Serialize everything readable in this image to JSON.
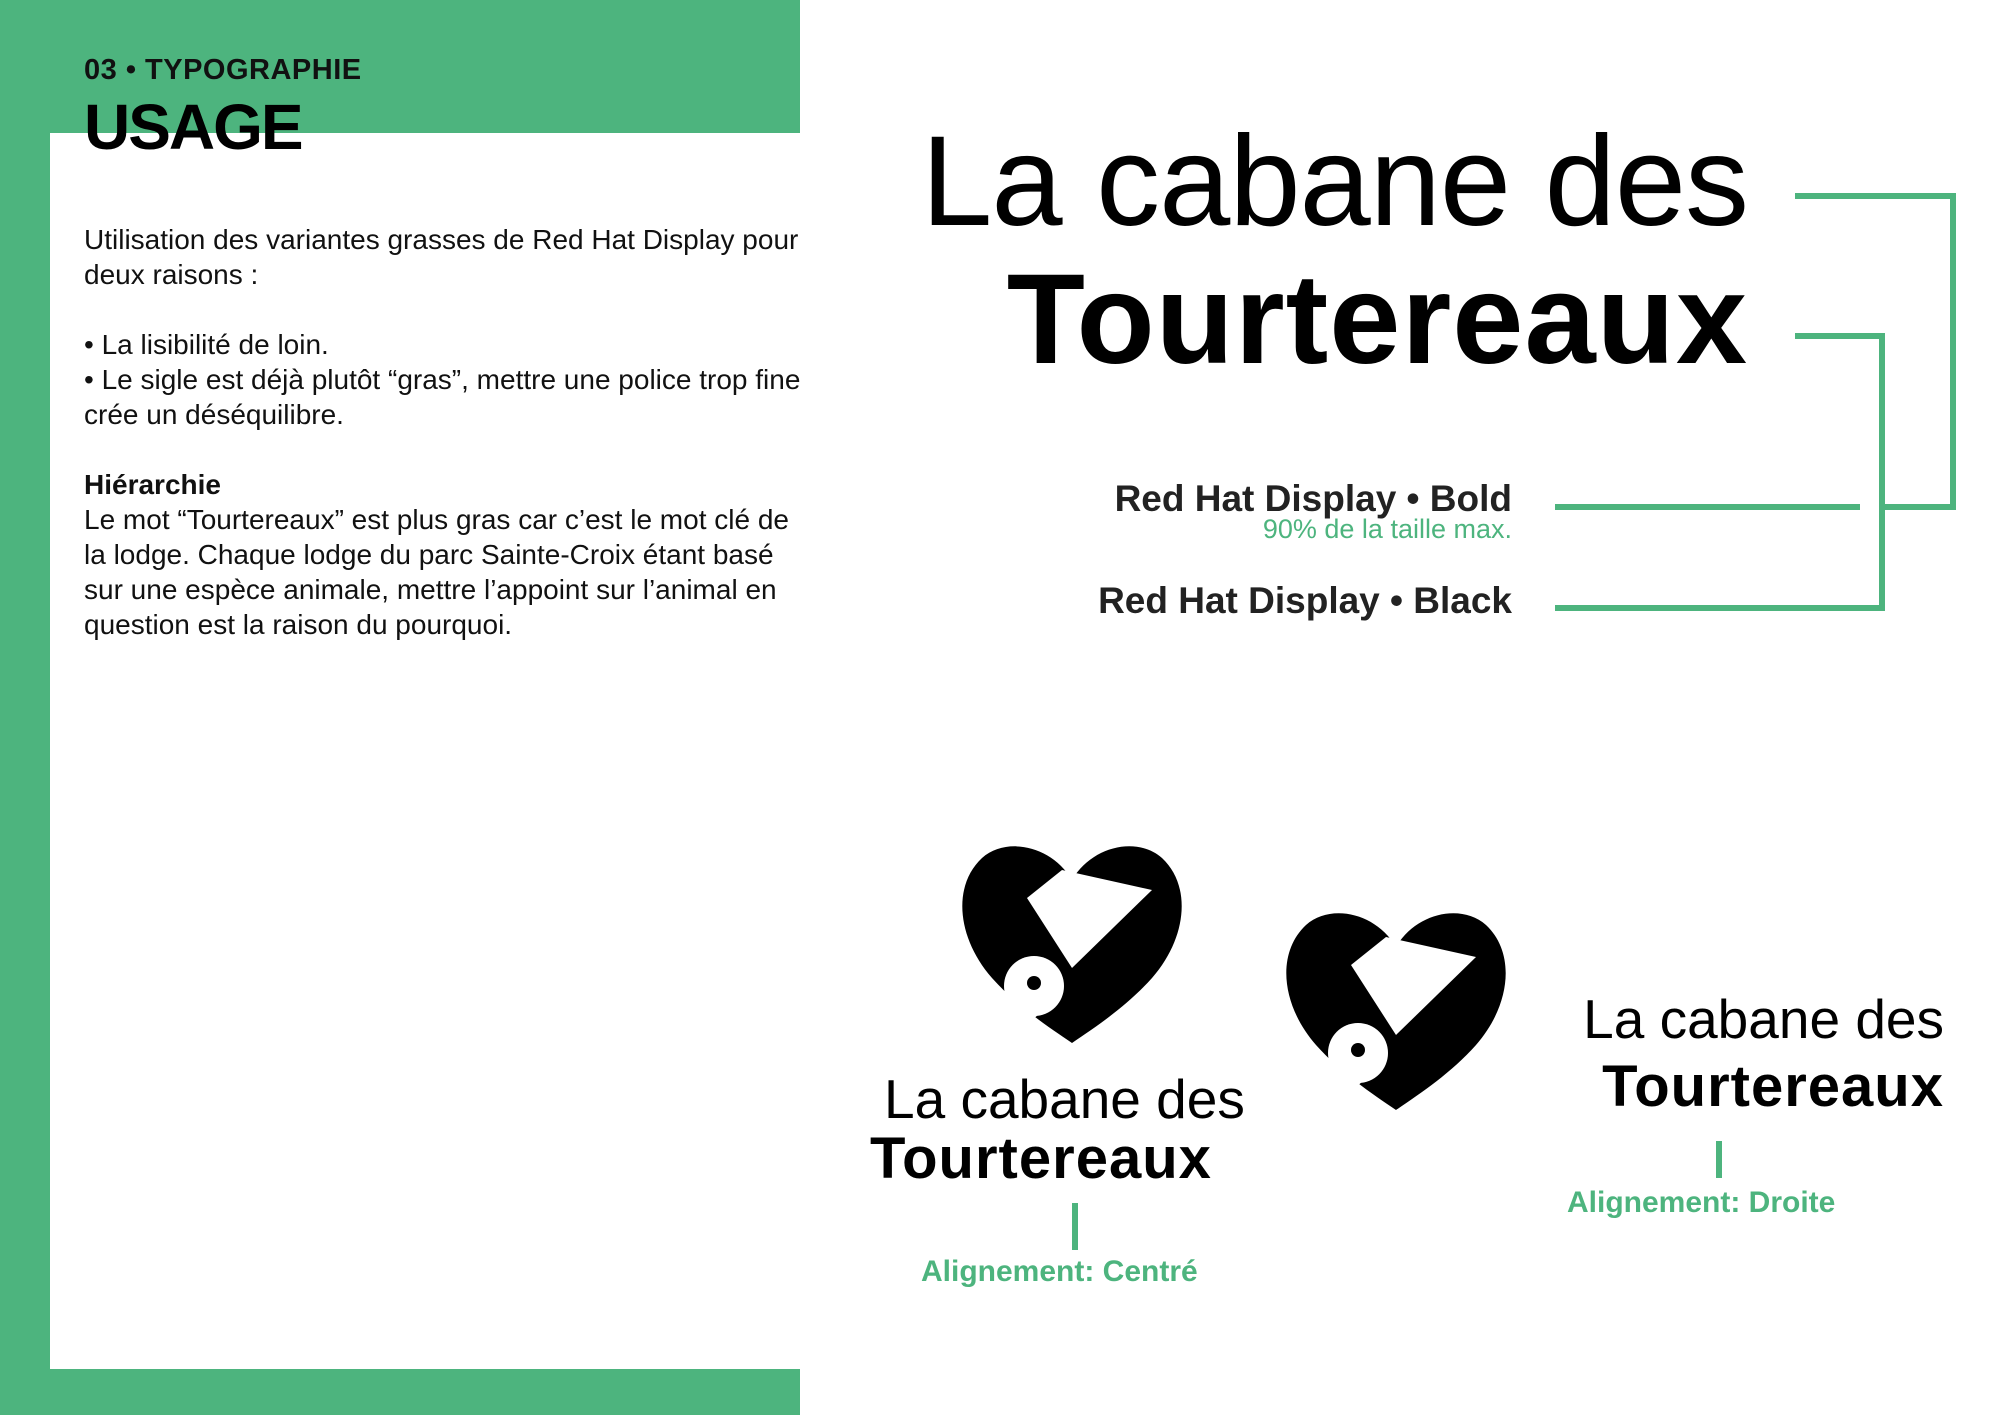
{
  "header": {
    "section_label": "03 • TYPOGRAPHIE",
    "title": "USAGE"
  },
  "body": {
    "intro": "Utilisation des variantes grasses de Red Hat Display pour deux raisons :",
    "bullet1": "• La lisibilité de loin.",
    "bullet2": "• Le sigle est déjà plutôt “gras”, mettre une police trop fine crée un déséquilibre.",
    "subheading": "Hiérarchie",
    "paragraph": "Le mot “Tourtereaux” est plus gras car c’est le mot clé de la lodge. Chaque lodge du parc Sainte-Croix étant basé sur une espèce animale, mettre l’appoint sur l’animal en question est la raison du pourquoi."
  },
  "specimen": {
    "line1": "La cabane des",
    "line2": "Tourtereaux",
    "font1_label": "Red Hat Display • Bold",
    "font1_note": "90% de la taille max.",
    "font2_label": "Red Hat Display • Black"
  },
  "logos": {
    "centered": {
      "line1": "La cabane des",
      "line2": "Tourtereaux",
      "caption": "Alignement: Centré"
    },
    "right": {
      "line1": "La cabane des",
      "line2": "Tourtereaux",
      "caption": "Alignement: Droite"
    },
    "mark_icon": "heart-bird-icon"
  },
  "colors": {
    "accent": "#4db47e",
    "text": "#111111",
    "background": "#ffffff"
  }
}
